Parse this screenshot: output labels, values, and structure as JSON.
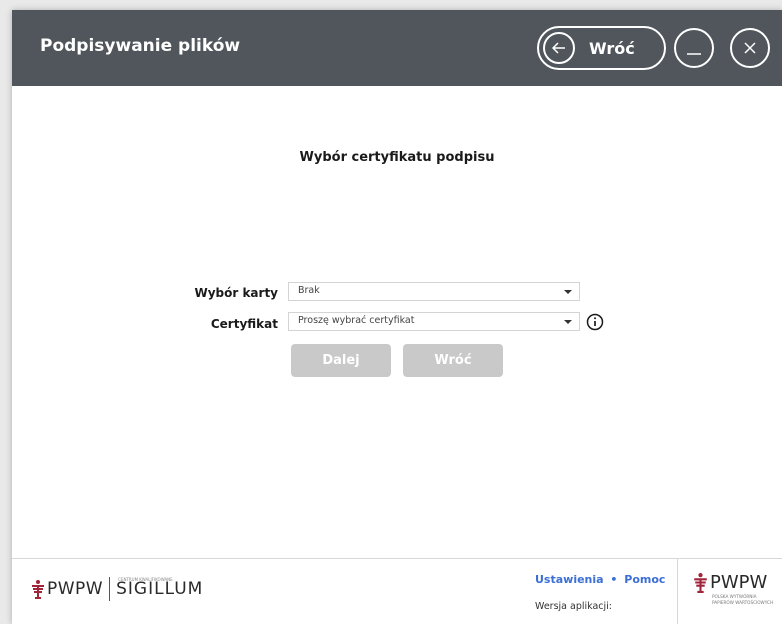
{
  "window": {
    "title": "Podpisywanie plików"
  },
  "titlebar": {
    "back_label": "Wróć"
  },
  "main": {
    "section_title": "Wybór certyfikatu podpisu",
    "card_label": "Wybór karty",
    "card_value": "Brak",
    "certificate_label": "Certyfikat",
    "certificate_value": "Proszę wybrać certyfikat",
    "next_button": "Dalej",
    "back_button": "Wróć"
  },
  "footer": {
    "logo_left_pwpw": "PWPW",
    "logo_left_small": "CENTRUM KWALIFIKOWANE",
    "logo_left_sigillum": "SIGILLUM",
    "settings_link": "Ustawienia",
    "separator": "•",
    "help_link": "Pomoc",
    "version_label": "Wersja aplikacji:",
    "logo_right_pwpw": "PWPW",
    "logo_right_sub1": "POLSKA WYTWÓRNIA",
    "logo_right_sub2": "PAPIERÓW WARTOŚCIOWYCH"
  },
  "colors": {
    "titlebar": "#50565c",
    "link": "#3b6fd6",
    "disabled_button": "#c9c9c9",
    "brand_red": "#a0253a"
  },
  "icons": [
    "arrow-left-icon",
    "minimize-icon",
    "close-icon",
    "chevron-down-icon",
    "info-icon",
    "pwpw-eagle-icon"
  ]
}
